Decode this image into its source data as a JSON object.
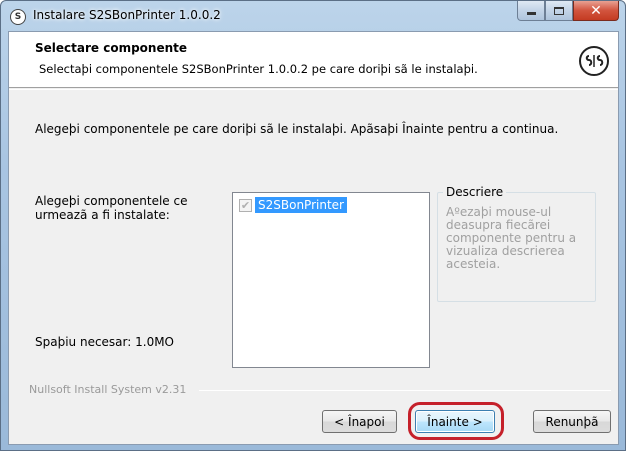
{
  "window": {
    "title": "Instalare S2SBonPrinter 1.0.0.2",
    "app_icon_text": "S"
  },
  "header": {
    "title": "Selectare componente",
    "subtitle": "Selectaþi componentele S2SBonPrinter 1.0.0.2 pe care doriþi sã le instalaþi.",
    "logo_icon": "s2s-logo-icon"
  },
  "intro": "Alegeþi componentele pe care doriþi sã le instalaþi. Apãsaþi Înainte pentru a continua.",
  "components": {
    "label": "Alegeþi componentele ce urmeazã a fi instalate:",
    "items": [
      {
        "label": "S2SBonPrinter",
        "checked": true,
        "disabled": true,
        "selected": true
      }
    ]
  },
  "description": {
    "legend": "Descriere",
    "text": "Aºezaþi mouse-ul deasupra fiecãrei componente pentru a vizualiza descrierea acesteia."
  },
  "space_required": "Spaþiu necesar: 1.0MO",
  "branding": "Nullsoft Install System v2.31",
  "buttons": {
    "back": "< Înapoi",
    "next": "Înainte >",
    "cancel": "Renunþã"
  },
  "colors": {
    "highlight": "#c5202a",
    "selection": "#3399ff"
  }
}
